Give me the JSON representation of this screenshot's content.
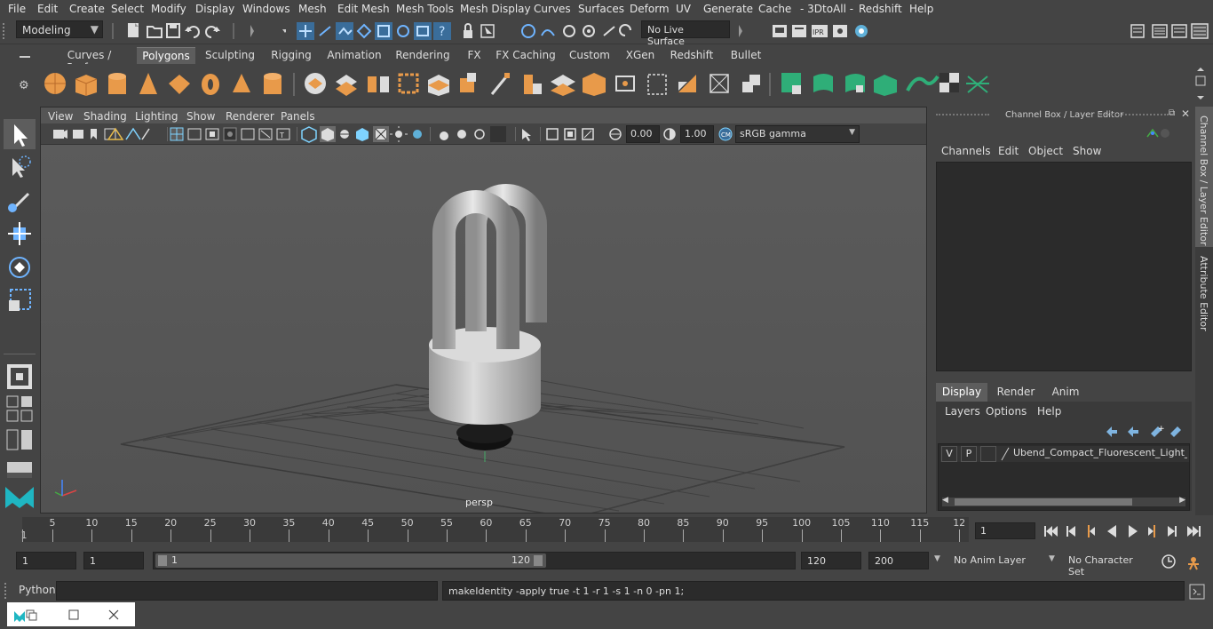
{
  "menubar": {
    "items": [
      "File",
      "Edit",
      "Create",
      "Select",
      "Modify",
      "Display",
      "Windows",
      "Mesh",
      "Edit Mesh",
      "Mesh Tools",
      "Mesh Display",
      "Curves",
      "Surfaces",
      "Deform",
      "UV",
      "Generate",
      "Cache",
      "- 3DtoAll -",
      "Redshift",
      "Help"
    ]
  },
  "status": {
    "mode": "Modeling",
    "live_surface": "No Live Surface"
  },
  "shelf": {
    "tabs": [
      "Curves / Surfaces",
      "Polygons",
      "Sculpting",
      "Rigging",
      "Animation",
      "Rendering",
      "FX",
      "FX Caching",
      "Custom",
      "XGen",
      "Redshift",
      "Bullet"
    ],
    "active_tab": "Polygons"
  },
  "viewport": {
    "menu": [
      "View",
      "Shading",
      "Lighting",
      "Show",
      "Renderer",
      "Panels"
    ],
    "exposure": "0.00",
    "gamma": "1.00",
    "color_space": "sRGB gamma",
    "camera_label": "persp"
  },
  "channel_box": {
    "title": "Channel Box / Layer Editor",
    "menu": [
      "Channels",
      "Edit",
      "Object",
      "Show"
    ],
    "layer_tabs": [
      "Display",
      "Render",
      "Anim"
    ],
    "active_layer_tab": "Display",
    "layer_menu": [
      "Layers",
      "Options",
      "Help"
    ],
    "layer": {
      "v": "V",
      "p": "P",
      "name": "Ubend_Compact_Fluorescent_Light_Bulb"
    }
  },
  "side_tabs": [
    "Channel Box / Layer Editor",
    "Attribute Editor"
  ],
  "timeline": {
    "ticks": [
      5,
      10,
      15,
      20,
      25,
      30,
      35,
      40,
      45,
      50,
      55,
      60,
      65,
      70,
      75,
      80,
      85,
      90,
      95,
      100,
      105,
      110,
      115,
      12
    ],
    "start_marker": "1",
    "current_frame": "1"
  },
  "range": {
    "start": "1",
    "anim_start": "1",
    "range_start": "1",
    "range_end": "120",
    "end": "120",
    "anim_end": "200",
    "anim_layer": "No Anim Layer",
    "character_set": "No Character Set"
  },
  "cmdline": {
    "language": "Python",
    "feedback": "makeIdentity -apply true -t 1 -r 1 -s 1 -n 0 -pn 1;"
  }
}
